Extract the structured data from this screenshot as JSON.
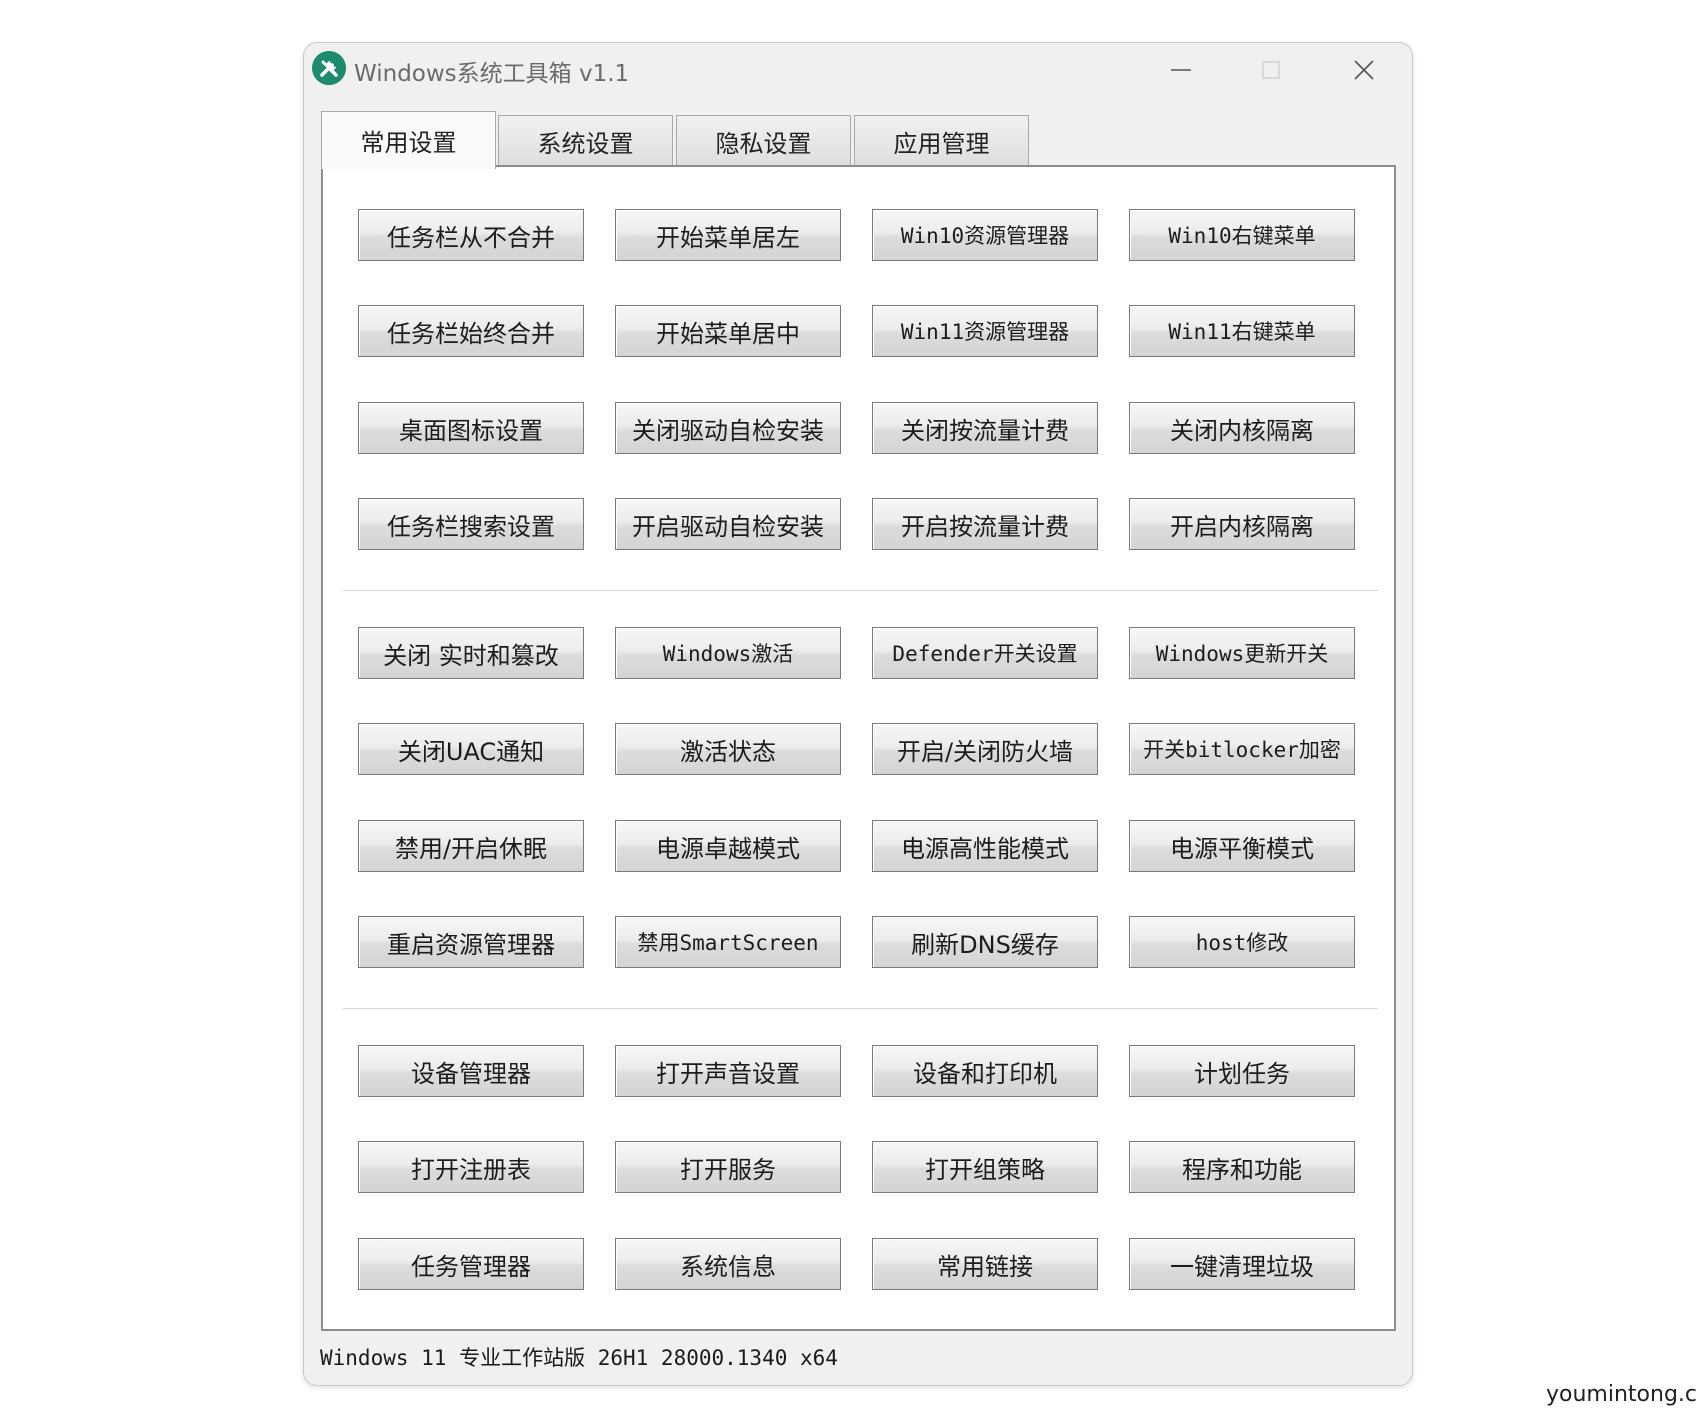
{
  "window": {
    "title": "Windows系统工具箱 v1.1",
    "icon": "tools-icon",
    "accent_color": "#1e8a6e"
  },
  "tabs": [
    {
      "label": "常用设置",
      "active": true
    },
    {
      "label": "系统设置",
      "active": false
    },
    {
      "label": "隐私设置",
      "active": false
    },
    {
      "label": "应用管理",
      "active": false
    }
  ],
  "groups": [
    {
      "buttons": [
        "任务栏从不合并",
        "开始菜单居左",
        "Win10资源管理器",
        "Win10右键菜单",
        "任务栏始终合并",
        "开始菜单居中",
        "Win11资源管理器",
        "Win11右键菜单",
        "桌面图标设置",
        "关闭驱动自检安装",
        "关闭按流量计费",
        "关闭内核隔离",
        "任务栏搜索设置",
        "开启驱动自检安装",
        "开启按流量计费",
        "开启内核隔离"
      ]
    },
    {
      "buttons": [
        "关闭 实时和篡改",
        "Windows激活",
        "Defender开关设置",
        "Windows更新开关",
        "关闭UAC通知",
        "激活状态",
        "开启/关闭防火墙",
        "开关bitlocker加密",
        "禁用/开启休眠",
        "电源卓越模式",
        "电源高性能模式",
        "电源平衡模式",
        "重启资源管理器",
        "禁用SmartScreen",
        "刷新DNS缓存",
        "host修改"
      ]
    },
    {
      "buttons": [
        "设备管理器",
        "打开声音设置",
        "设备和打印机",
        "计划任务",
        "打开注册表",
        "打开服务",
        "打开组策略",
        "程序和功能",
        "任务管理器",
        "系统信息",
        "常用链接",
        "一键清理垃圾"
      ]
    }
  ],
  "status_bar": {
    "text": "Windows 11 专业工作站版 26H1 28000.1340 x64"
  },
  "watermark": "youmintong.cn"
}
